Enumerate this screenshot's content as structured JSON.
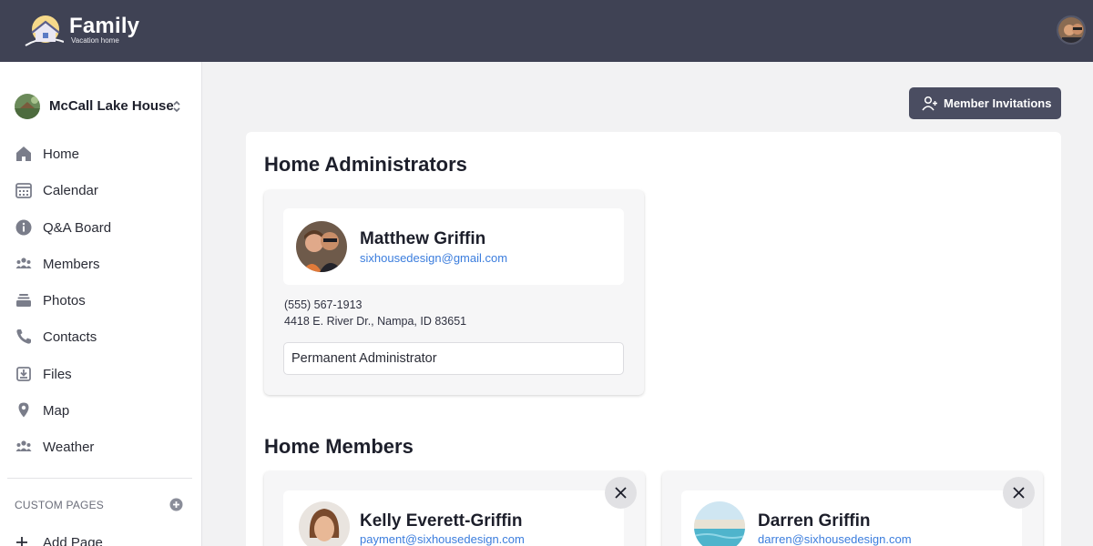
{
  "brand": {
    "name": "Family",
    "tagline": "Vacation home"
  },
  "sidebar": {
    "home_name": "McCall Lake House",
    "items": [
      {
        "label": "Home",
        "icon": "home-icon"
      },
      {
        "label": "Calendar",
        "icon": "calendar-icon"
      },
      {
        "label": "Q&A Board",
        "icon": "info-icon"
      },
      {
        "label": "Members",
        "icon": "members-icon"
      },
      {
        "label": "Photos",
        "icon": "photos-icon"
      },
      {
        "label": "Contacts",
        "icon": "phone-icon"
      },
      {
        "label": "Files",
        "icon": "files-icon"
      },
      {
        "label": "Map",
        "icon": "map-pin-icon"
      },
      {
        "label": "Weather",
        "icon": "weather-icon"
      }
    ],
    "custom_pages_title": "CUSTOM PAGES",
    "add_page_label": "Add Page"
  },
  "toolbar": {
    "invite_label": "Member Invitations"
  },
  "admins": {
    "title": "Home Administrators",
    "items": [
      {
        "name": "Matthew Griffin",
        "email": "sixhousedesign@gmail.com",
        "phone": "(555) 567-1913",
        "address": "4418 E. River Dr., Nampa, ID 83651",
        "role": "Permanent Administrator"
      }
    ]
  },
  "members": {
    "title": "Home Members",
    "items": [
      {
        "name": "Kelly Everett-Griffin",
        "email": "payment@sixhousedesign.com"
      },
      {
        "name": "Darren Griffin",
        "email": "darren@sixhousedesign.com"
      }
    ]
  },
  "colors": {
    "topbar": "#3f4254",
    "accent_link": "#3b7ddd",
    "button": "#4a4d61"
  }
}
